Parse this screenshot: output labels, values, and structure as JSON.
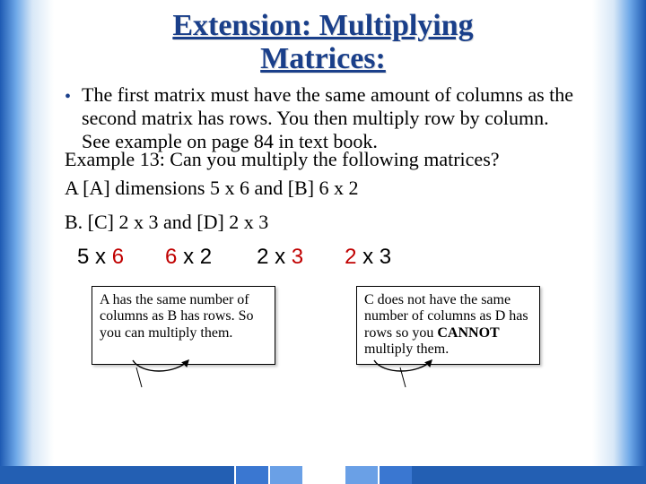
{
  "title_line1": "Extension: Multiplying",
  "title_line2": "Matrices:",
  "bullet": "The first matrix must have the same amount of columns as the second matrix has rows.  You then multiply row by column.  See example on page 84 in text book.",
  "example_q": "Example 13:  Can you multiply the following matrices?",
  "partA": "A  [A] dimensions 5 x 6 and [B]  6 x 2",
  "partB": "B.  [C] 2 x 3 and [D] 2 x 3",
  "dims": {
    "a1_pre": "5 x ",
    "a1_red": "6",
    "a2_red": "6 ",
    "a2_post": "x 2",
    "b1_pre": "2 x ",
    "b1_red": "3",
    "b2_red": "2 ",
    "b2_post": "x 3"
  },
  "annotA": "A has the same number of columns as B has rows.  So you can multiply them.",
  "annotB_pre": "C does not have the same number of columns as D has rows so you ",
  "annotB_bold": "CANNOT",
  "annotB_post": " multiply them."
}
